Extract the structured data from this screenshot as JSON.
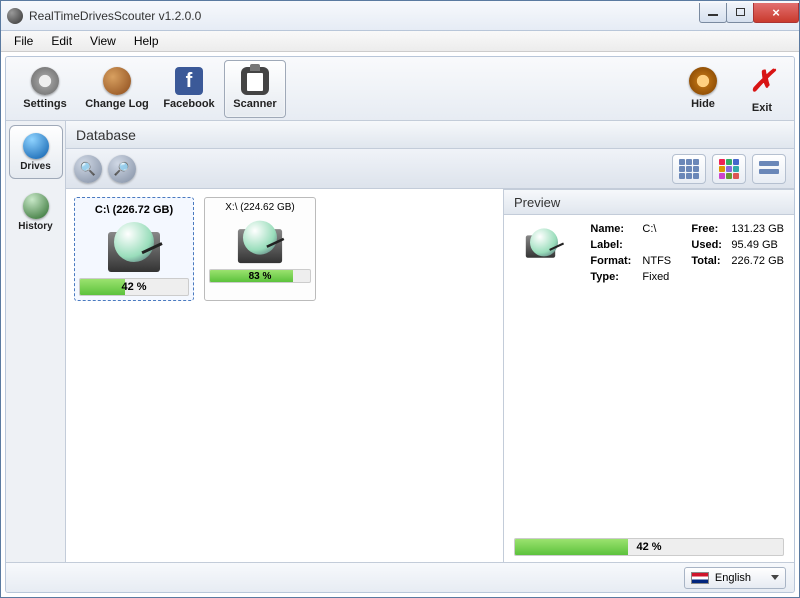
{
  "title": "RealTimeDrivesScouter v1.2.0.0",
  "menu": {
    "file": "File",
    "edit": "Edit",
    "view": "View",
    "help": "Help"
  },
  "toolbar": {
    "settings": "Settings",
    "changelog": "Change Log",
    "facebook": "Facebook",
    "scanner": "Scanner",
    "hide": "Hide",
    "exit": "Exit"
  },
  "sidetabs": {
    "drives": "Drives",
    "history": "History"
  },
  "db": {
    "header": "Database"
  },
  "drives": [
    {
      "title": "C:\\ (226.72 GB)",
      "percent": 42,
      "percent_label": "42 %",
      "selected": true
    },
    {
      "title": "X:\\ (224.62 GB)",
      "percent": 83,
      "percent_label": "83 %",
      "selected": false
    }
  ],
  "preview": {
    "header": "Preview",
    "name_k": "Name:",
    "name_v": "C:\\",
    "label_k": "Label:",
    "label_v": "",
    "format_k": "Format:",
    "format_v": "NTFS",
    "type_k": "Type:",
    "type_v": "Fixed",
    "free_k": "Free:",
    "free_v": "131.23 GB",
    "used_k": "Used:",
    "used_v": "95.49 GB",
    "total_k": "Total:",
    "total_v": "226.72 GB",
    "percent": 42,
    "percent_label": "42 %"
  },
  "lang": {
    "label": "English"
  }
}
